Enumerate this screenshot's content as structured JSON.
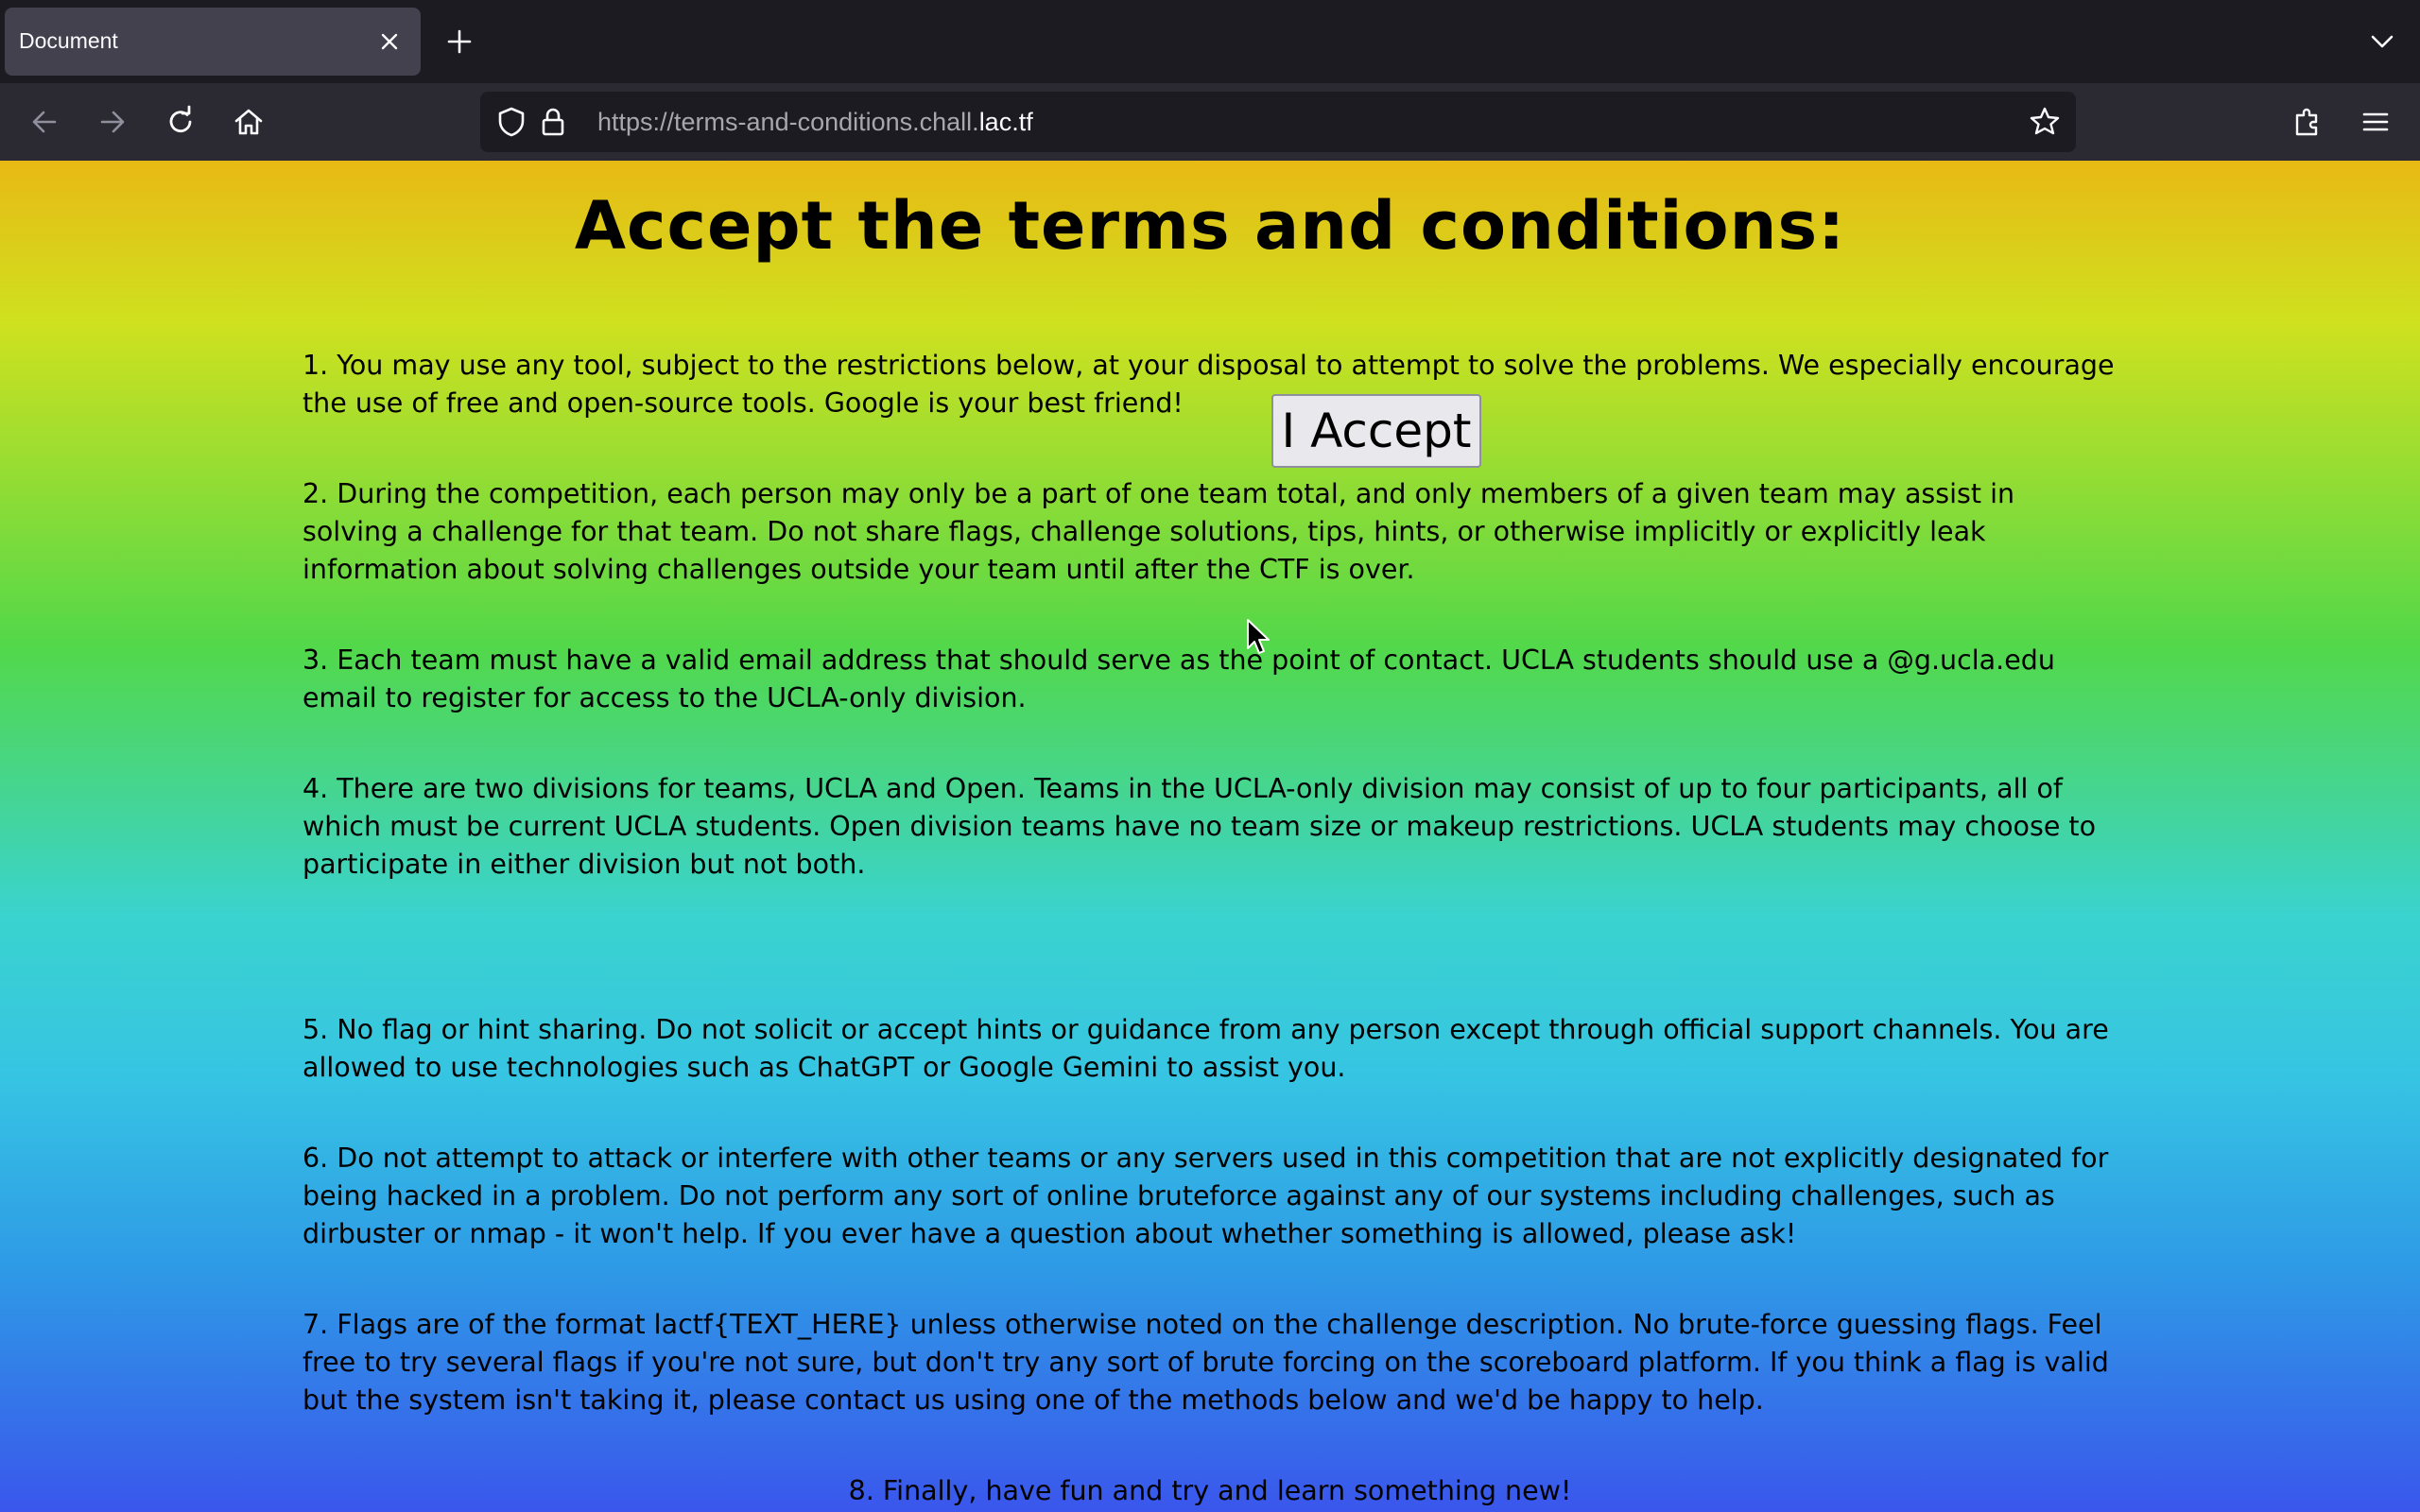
{
  "browser": {
    "tab": {
      "title": "Document"
    },
    "url": {
      "prefix": "https://terms-and-conditions.chall.",
      "domain": "lac.tf"
    }
  },
  "page": {
    "title": "Accept the terms and conditions:",
    "accept_button": "I Accept",
    "terms": [
      "1. You may use any tool, subject to the restrictions below, at your disposal to attempt to solve the problems. We especially encourage the use of free and open-source tools. Google is your best friend!",
      "2. During the competition, each person may only be a part of one team total, and only members of a given team may assist in solving a challenge for that team. Do not share flags, challenge solutions, tips, hints, or otherwise implicitly or explicitly leak information about solving challenges outside your team until after the CTF is over.",
      "3. Each team must have a valid email address that should serve as the point of contact. UCLA students should use a @g.ucla.edu email to register for access to the UCLA-only division.",
      "4. There are two divisions for teams, UCLA and Open. Teams in the UCLA-only division may consist of up to four participants, all of which must be current UCLA students. Open division teams have no team size or makeup restrictions. UCLA students may choose to participate in either division but not both.",
      "5. No flag or hint sharing. Do not solicit or accept hints or guidance from any person except through official support channels. You are allowed to use technologies such as ChatGPT or Google Gemini to assist you.",
      "6. Do not attempt to attack or interfere with other teams or any servers used in this competition that are not explicitly designated for being hacked in a problem. Do not perform any sort of online bruteforce against any of our systems including challenges, such as dirbuster or nmap - it won't help. If you ever have a question about whether something is allowed, please ask!",
      "7. Flags are of the format lactf{TEXT_HERE} unless otherwise noted on the challenge description. No brute-force guessing flags. Feel free to try several flags if you're not sure, but don't try any sort of brute forcing on the scoreboard platform. If you think a flag is valid but the system isn't taking it, please contact us using one of the methods below and we'd be happy to help.",
      "8. Finally, have fun and try and learn something new!"
    ]
  },
  "icons": {
    "tab_close": "close-icon",
    "new_tab": "plus-icon",
    "tab_list": "chevron-down-icon",
    "back": "back-arrow-icon",
    "forward": "forward-arrow-icon",
    "reload": "reload-icon",
    "home": "home-icon",
    "tracking": "shield-icon",
    "lock": "lock-icon",
    "bookmark": "star-icon",
    "extensions": "puzzle-icon",
    "menu": "hamburger-menu-icon",
    "cursor": "mouse-pointer-icon"
  }
}
